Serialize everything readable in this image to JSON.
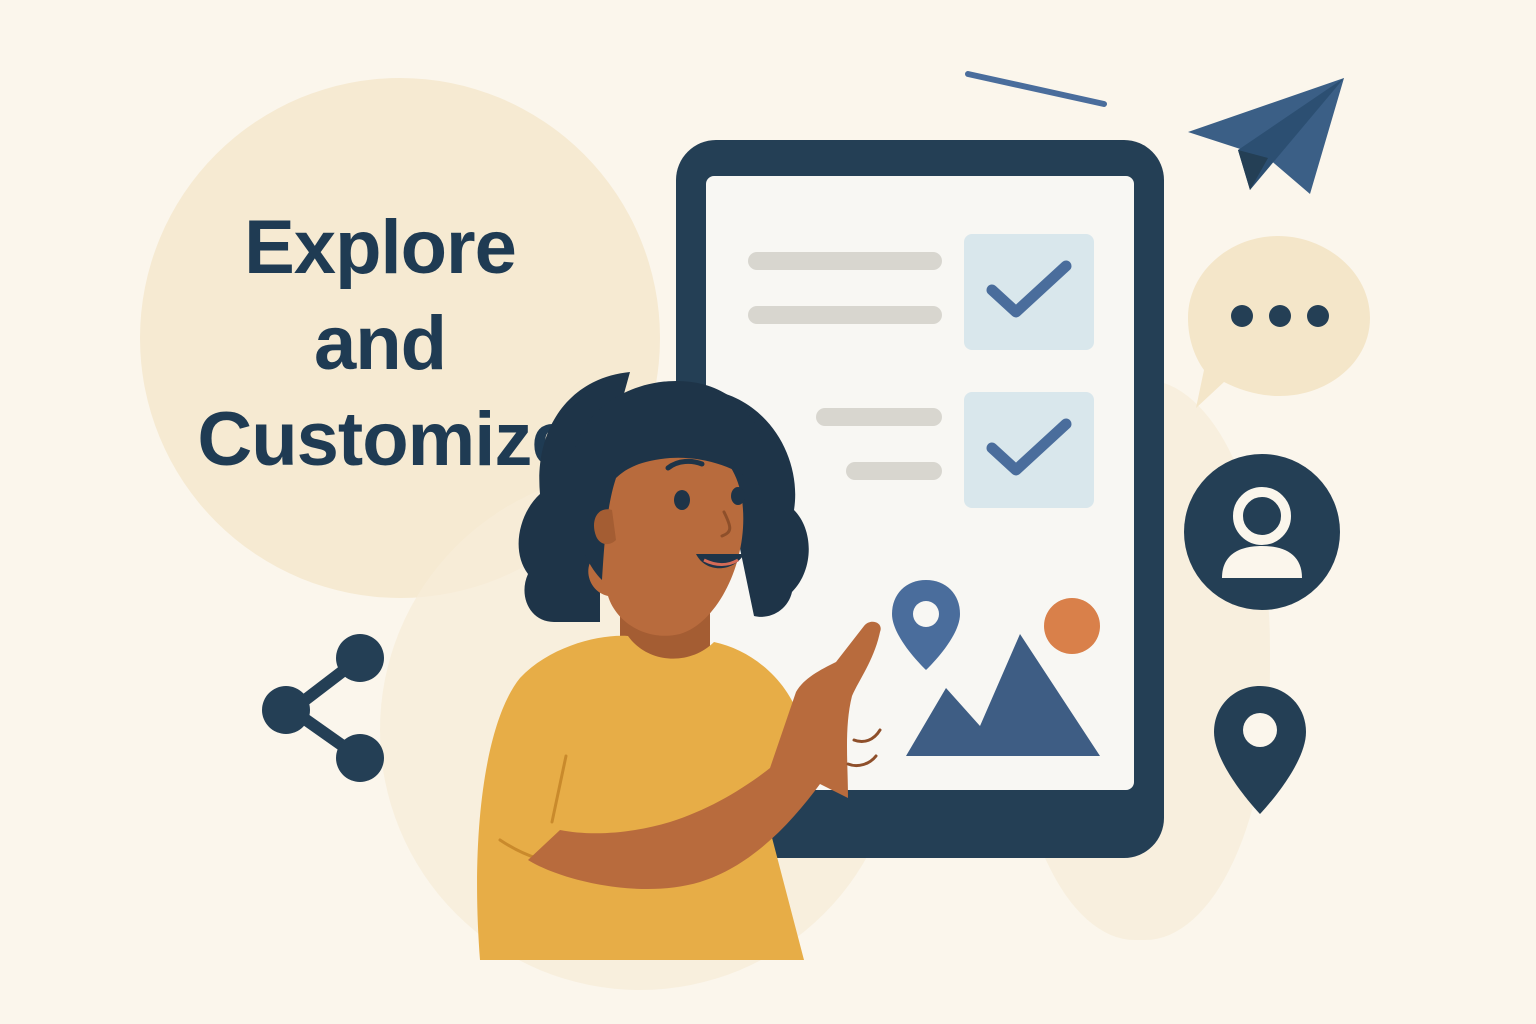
{
  "headline": {
    "line1": "Explore",
    "line2": "and",
    "line3": "Customize"
  },
  "tablet": {
    "checklist": [
      {
        "checked": true
      },
      {
        "checked": true
      }
    ]
  },
  "icons": {
    "plane": "paper-plane-icon",
    "chat": "chat-bubble-icon",
    "user": "user-profile-icon",
    "pin": "location-pin-icon",
    "share": "share-icon",
    "image": "image-icon",
    "check": "checkmark-icon"
  },
  "colors": {
    "background": "#fbf6ec",
    "navy": "#243f55",
    "blue_accent": "#4a6d9c",
    "orange_accent": "#d9804a",
    "shirt": "#e7ad47",
    "skin": "#b86b3d",
    "check_box": "#d9e7ec"
  }
}
